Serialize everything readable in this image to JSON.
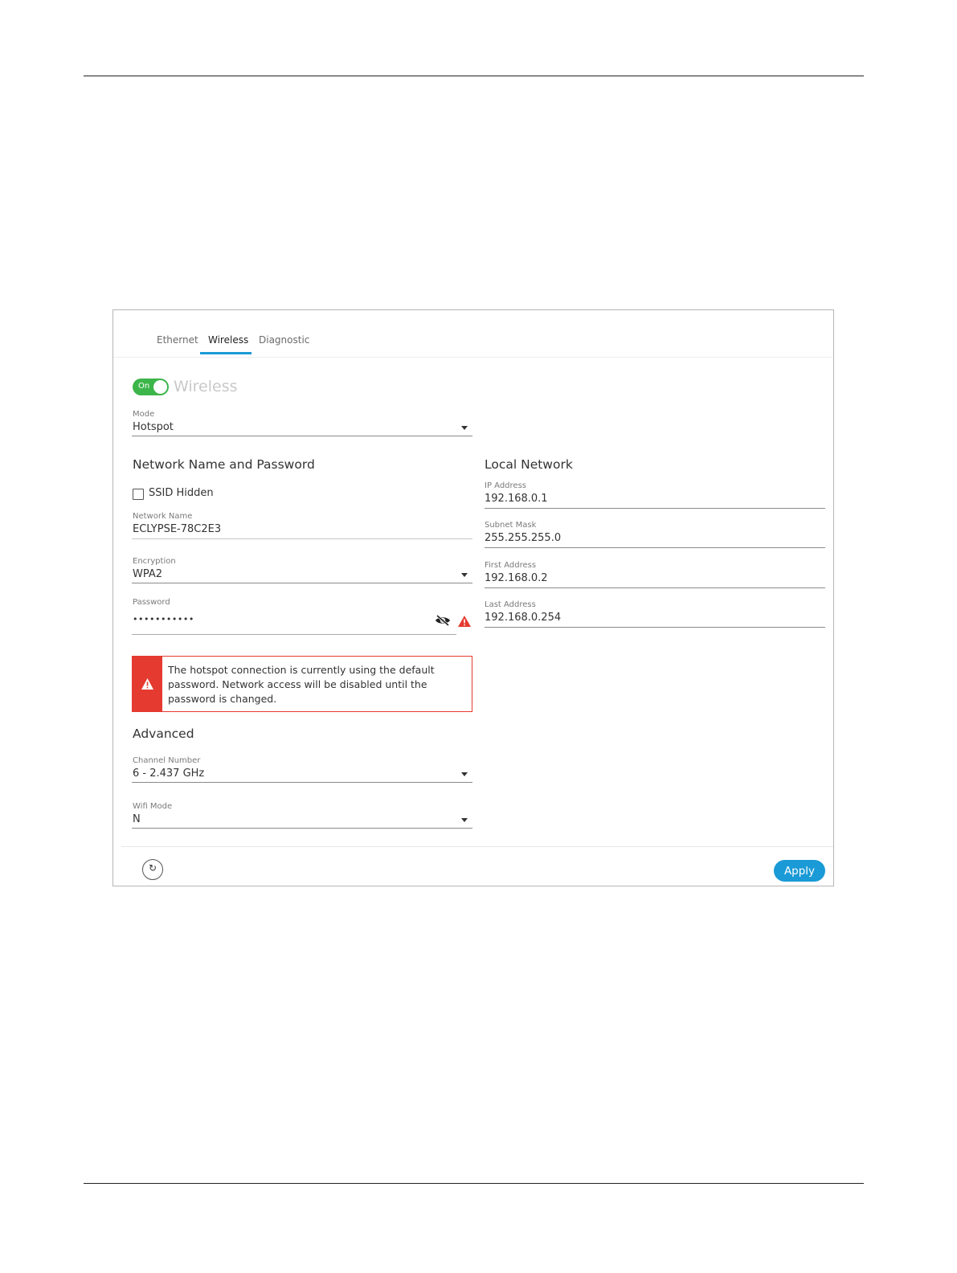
{
  "tabs": [
    {
      "label": "Ethernet"
    },
    {
      "label": "Wireless",
      "active": true
    },
    {
      "label": "Diagnostic"
    }
  ],
  "wireless": {
    "toggle_label": "On",
    "enabled": true,
    "title": "Wireless"
  },
  "mode": {
    "label": "Mode",
    "value": "Hotspot"
  },
  "network_section": {
    "title": "Network Name and Password",
    "ssid_hidden": {
      "label": "SSID Hidden",
      "checked": false
    },
    "network_name": {
      "label": "Network Name",
      "value": "ECLYPSE-78C2E3"
    },
    "encryption": {
      "label": "Encryption",
      "value": "WPA2"
    },
    "password": {
      "label": "Password",
      "value": "•••••••••••"
    }
  },
  "alert": {
    "text": "The hotspot connection is currently using the default password. Network access will be disabled until the password is changed.",
    "color": "#e53a30"
  },
  "advanced": {
    "title": "Advanced",
    "channel": {
      "label": "Channel Number",
      "value": "6 - 2.437 GHz"
    },
    "wifi_mode": {
      "label": "Wifi Mode",
      "value": "N"
    }
  },
  "local_network": {
    "title": "Local Network",
    "ip_address": {
      "label": "IP Address",
      "value": "192.168.0.1"
    },
    "subnet_mask": {
      "label": "Subnet Mask",
      "value": "255.255.255.0"
    },
    "first_address": {
      "label": "First Address",
      "value": "192.168.0.2"
    },
    "last_address": {
      "label": "Last Address",
      "value": "192.168.0.254"
    }
  },
  "footer": {
    "refresh_icon": "refresh-icon",
    "apply_label": "Apply"
  },
  "colors": {
    "accent": "#1a9ad6",
    "toggle_on": "#3cb54a",
    "error": "#e53a30"
  }
}
